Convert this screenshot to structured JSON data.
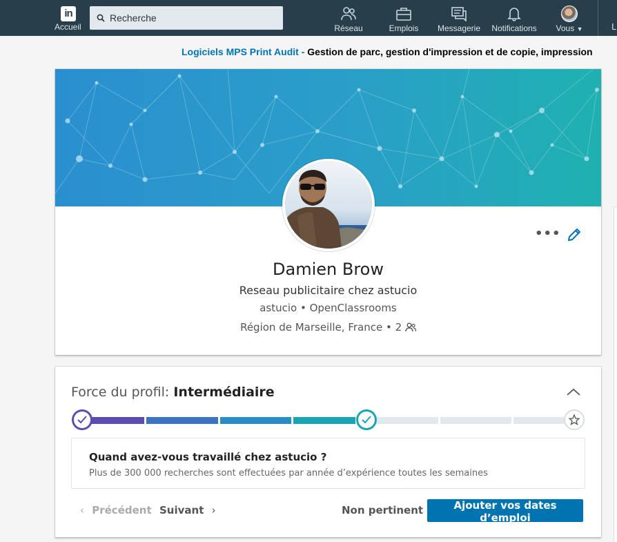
{
  "topnav": {
    "home_label": "Accueil",
    "search_placeholder": "Recherche",
    "items": [
      {
        "label": "Réseau",
        "icon": "network-icon"
      },
      {
        "label": "Emplois",
        "icon": "briefcase-icon"
      },
      {
        "label": "Messagerie",
        "icon": "messaging-icon"
      },
      {
        "label": "Notifications",
        "icon": "bell-icon"
      },
      {
        "label": "Vous",
        "icon": "avatar"
      }
    ],
    "trailing_label": "L",
    "logo_text": "in",
    "bg_color": "#283e4a"
  },
  "ad": {
    "advertiser": "Logiciels MPS Print Audit - ",
    "text": "Gestion de parc, gestion d'impression et de copie, impression"
  },
  "profile": {
    "name": "Damien Brow",
    "headline": "Reseau publicitaire chez astucio",
    "orgs": "astucio • OpenClassrooms",
    "location": "Région de Marseille, France • 2",
    "more_label": "•••"
  },
  "strength": {
    "label": "Force du profil: ",
    "level": "Intermédiaire",
    "progress_steps_completed": 4,
    "progress_steps_total": 7,
    "suggestion_title": "Quand avez-vous travaillé chez astucio ?",
    "suggestion_desc": "Plus de 300 000 recherches sont effectuées par année d’expérience toutes les semaines",
    "prev_label": "Précédent",
    "next_label": "Suivant",
    "not_relevant_label": "Non pertinent",
    "add_button_label": "Ajouter vos dates d’emploi"
  },
  "colors": {
    "accent": "#0073b1",
    "meter_1": "#5c4db1",
    "meter_2": "#3e73bf",
    "meter_3": "#2a8cc2",
    "meter_4": "#1aa4b4",
    "meter_rest": "#e1e9ee"
  }
}
